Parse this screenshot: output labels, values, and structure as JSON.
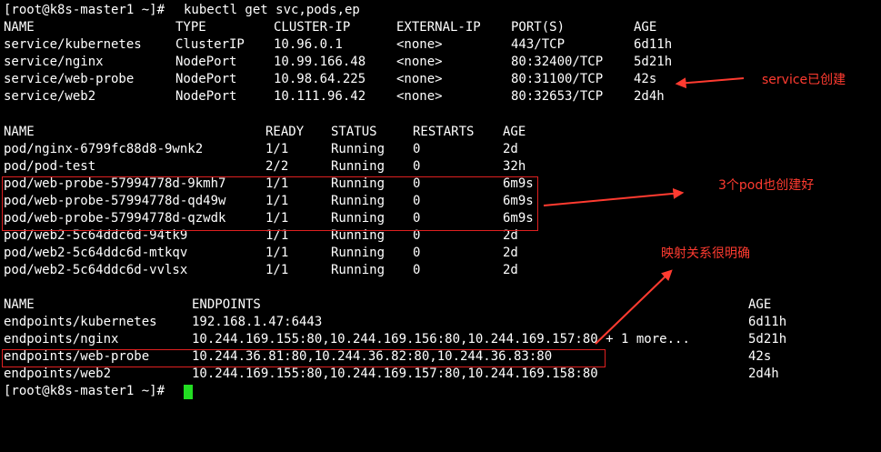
{
  "terminal": {
    "prompt": "[root@k8s-master1 ~]# ",
    "command": "kubectl get svc,pods,ep",
    "services": {
      "headers": [
        "NAME",
        "TYPE",
        "CLUSTER-IP",
        "EXTERNAL-IP",
        "PORT(S)",
        "AGE"
      ],
      "rows": [
        [
          "service/kubernetes",
          "ClusterIP",
          "10.96.0.1",
          "<none>",
          "443/TCP",
          "6d11h"
        ],
        [
          "service/nginx",
          "NodePort",
          "10.99.166.48",
          "<none>",
          "80:32400/TCP",
          "5d21h"
        ],
        [
          "service/web-probe",
          "NodePort",
          "10.98.64.225",
          "<none>",
          "80:31100/TCP",
          "42s"
        ],
        [
          "service/web2",
          "NodePort",
          "10.111.96.42",
          "<none>",
          "80:32653/TCP",
          "2d4h"
        ]
      ]
    },
    "pods": {
      "headers": [
        "NAME",
        "READY",
        "STATUS",
        "RESTARTS",
        "AGE"
      ],
      "rows": [
        [
          "pod/nginx-6799fc88d8-9wnk2",
          "1/1",
          "Running",
          "0",
          "2d"
        ],
        [
          "pod/pod-test",
          "2/2",
          "Running",
          "0",
          "32h"
        ],
        [
          "pod/web-probe-57994778d-9kmh7",
          "1/1",
          "Running",
          "0",
          "6m9s"
        ],
        [
          "pod/web-probe-57994778d-qd49w",
          "1/1",
          "Running",
          "0",
          "6m9s"
        ],
        [
          "pod/web-probe-57994778d-qzwdk",
          "1/1",
          "Running",
          "0",
          "6m9s"
        ],
        [
          "pod/web2-5c64ddc6d-94tk9",
          "1/1",
          "Running",
          "0",
          "2d"
        ],
        [
          "pod/web2-5c64ddc6d-mtkqv",
          "1/1",
          "Running",
          "0",
          "2d"
        ],
        [
          "pod/web2-5c64ddc6d-vvlsx",
          "1/1",
          "Running",
          "0",
          "2d"
        ]
      ]
    },
    "endpoints": {
      "headers": [
        "NAME",
        "ENDPOINTS",
        "AGE"
      ],
      "rows": [
        [
          "endpoints/kubernetes",
          "192.168.1.47:6443",
          "6d11h"
        ],
        [
          "endpoints/nginx",
          "10.244.169.155:80,10.244.169.156:80,10.244.169.157:80 + 1 more...",
          "5d21h"
        ],
        [
          "endpoints/web-probe",
          "10.244.36.81:80,10.244.36.82:80,10.244.36.83:80",
          "42s"
        ],
        [
          "endpoints/web2",
          "10.244.169.155:80,10.244.169.157:80,10.244.169.158:80",
          "2d4h"
        ]
      ]
    },
    "final_prompt": "[root@k8s-master1 ~]# "
  },
  "annotations": {
    "service_created": "service已创建",
    "pods_created": "3个pod也创建好",
    "mapping_clear": "映射关系很明确"
  },
  "colors": {
    "background": "#000000",
    "text": "#ffffff",
    "annotation": "#ff3b30",
    "box": "#e02020",
    "cursor": "#22dd22"
  }
}
